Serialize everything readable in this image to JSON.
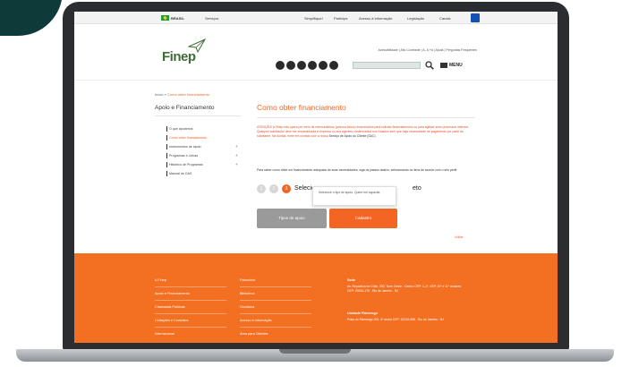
{
  "govbar": {
    "brasil": "BRASIL",
    "servicos": "Serviços",
    "links": [
      "Simplifique!",
      "Participe",
      "Acesso à informação",
      "Legislação",
      "Canais"
    ]
  },
  "header": {
    "logo": "Finep",
    "accessibility": "Acessibilidade | Alto Contraste | A- A +A | Ajuda | Perguntas Frequentes",
    "menu_label": "MENU"
  },
  "breadcrumb": {
    "home": "Início",
    "sep": " » ",
    "current": "Como obter financiamento"
  },
  "sidebar": {
    "title": "Apoio e Financiamento",
    "items": [
      {
        "label": "O que apoiamos"
      },
      {
        "label": "Como obter financiamento"
      },
      {
        "label": "Instrumentos de apoio"
      },
      {
        "label": "Programas e Linhas"
      },
      {
        "label": "Histórico de Programas"
      },
      {
        "label": "Manual do OAS"
      }
    ]
  },
  "main": {
    "title": "Como obter financiamento",
    "warning_prefix": "ATENÇÃO! A Finep não opera por meio de intermediários (pessoa física) remunerados para solicitar financiamentos ou para agilizar seus processos internos. Qualquer solicitação deve ser encaminhada à empresa ou aos agentes credenciados nos Estados sem que haja necessidade de pagamento por parte do solicitante. Na dúvida, entre em contato com a nossa ",
    "warning_link": "Serviço de Apoio ao Cliente (SAC).",
    "intro": "Para saber como obter um financiamento adequado às suas necessidades, siga os passos abaixo, selecionando os itens de acordo com o seu perfil:",
    "steps": [
      "1",
      "2",
      "3"
    ],
    "step_text": "Selecione",
    "step_text_end": "eto",
    "tooltip": "Selecione o tipo de apoio. Quem me capacita",
    "btn_type": "Tipos de apoio",
    "btn_register": "Cadastro",
    "back": "Voltar"
  },
  "footer": {
    "col1": [
      "A Finep",
      "Apoio e Financiamento",
      "Chamadas Públicas",
      "Licitações e Contratos",
      "Internacional"
    ],
    "col2": [
      "Patrocínio",
      "Biblioteca",
      "Ouvidoria",
      "Acesso à Informação",
      "Área para Clientes"
    ],
    "sede_title": "Sede",
    "sede_addr": "Av. República do Chile, 330, Torre Oeste - Centro CEP: 1-1º, CEP, 10º e 11º andares CEP: 20031-170 - Rio de Janeiro - RJ",
    "unit_title": "Unidade Flamengo",
    "unit_addr": "Praia do Flamengo 200, 3º andar CEP: 22210-065 - Rio de Janeiro - RJ"
  },
  "colors": {
    "accent": "#f26522",
    "footer": "#f36f21",
    "logo": "#3d6b36"
  }
}
